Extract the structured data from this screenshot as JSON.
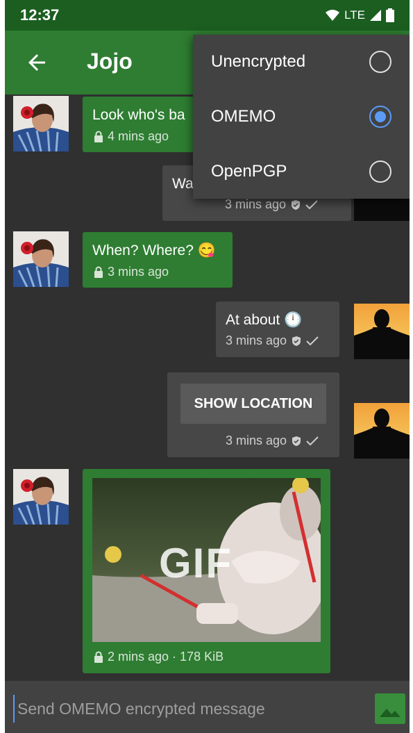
{
  "status": {
    "time": "12:37",
    "network": "LTE"
  },
  "header": {
    "title": "Jojo"
  },
  "menu": {
    "items": [
      {
        "label": "Unencrypted",
        "selected": false
      },
      {
        "label": "OMEMO",
        "selected": true
      },
      {
        "label": "OpenPGP",
        "selected": false
      }
    ]
  },
  "messages": [
    {
      "direction": "in",
      "text": "Look who's ba",
      "meta": "4 mins ago"
    },
    {
      "direction": "out",
      "text": "Wa",
      "meta": "3 mins ago"
    },
    {
      "direction": "in",
      "text": "When? Where? 😋",
      "meta": "3 mins ago"
    },
    {
      "direction": "out",
      "text": "At about 🕛",
      "meta": "3 mins ago"
    },
    {
      "direction": "out",
      "button": "SHOW LOCATION",
      "meta": "3 mins ago"
    },
    {
      "direction": "in",
      "image_label": "GIF",
      "meta": "2 mins ago · 178 KiB"
    }
  ],
  "composer": {
    "placeholder": "Send OMEMO encrypted message"
  },
  "colors": {
    "appbar": "#2e7d32",
    "statusbar": "#1b5e20",
    "background": "#303030",
    "incoming": "#2e7d32",
    "outgoing": "#474747",
    "accent": "#5b9bf5"
  },
  "icons": {
    "back": "arrow-left-icon",
    "lock": "lock-icon",
    "shield": "shield-check-icon",
    "check": "check-icon",
    "attach": "image-icon"
  }
}
